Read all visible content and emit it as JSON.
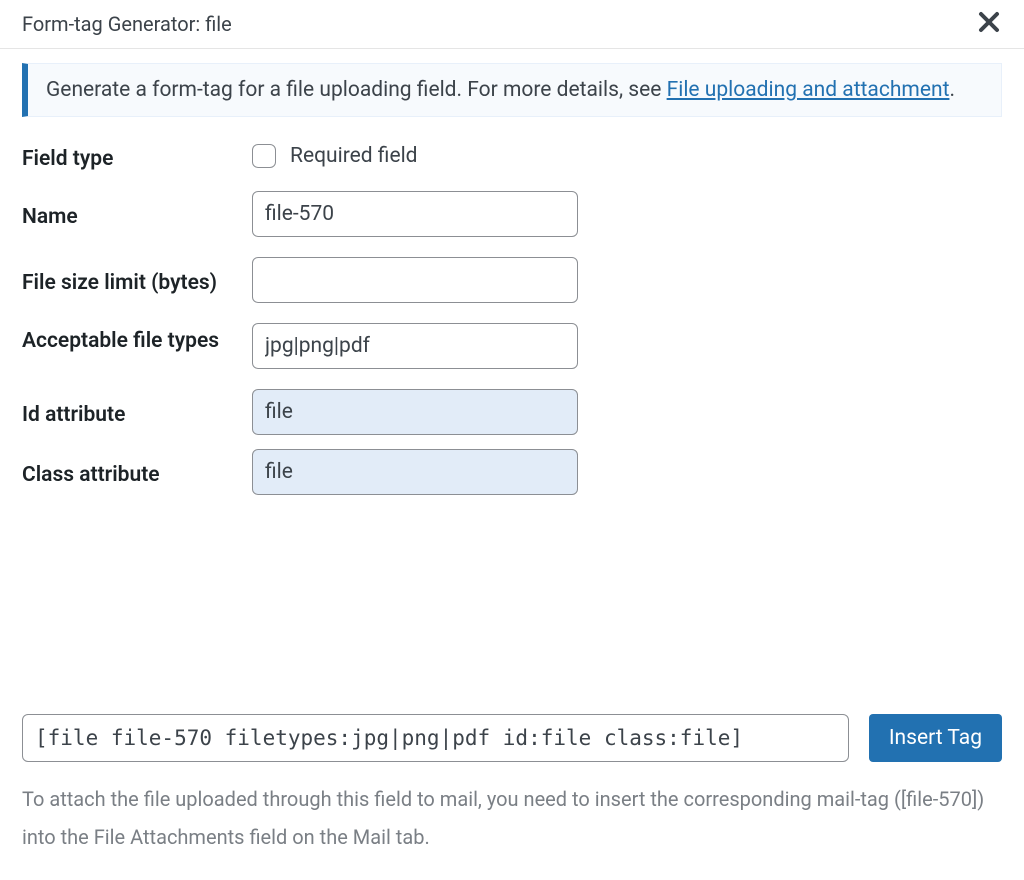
{
  "accent_color": "#2271b1",
  "header": {
    "title": "Form-tag Generator: file"
  },
  "description": {
    "text": "Generate a form-tag for a file uploading field. For more details, see ",
    "link_text": "File uploading and attachment",
    "suffix": "."
  },
  "fields": {
    "field_type": {
      "label": "Field type",
      "checkbox_label": "Required field",
      "checked": false
    },
    "name": {
      "label": "Name",
      "value": "file-570"
    },
    "limit": {
      "label": "File size limit (bytes)",
      "value": ""
    },
    "filetypes": {
      "label": "Acceptable file types",
      "value": "jpg|png|pdf"
    },
    "id_attr": {
      "label": "Id attribute",
      "value": "file"
    },
    "class_attr": {
      "label": "Class attribute",
      "value": "file"
    }
  },
  "output": {
    "tag": "[file file-570 filetypes:jpg|png|pdf id:file class:file]",
    "insert_label": "Insert Tag"
  },
  "help": {
    "pre": "To attach the file uploaded through this field to mail, you need to insert the corresponding mail-tag (",
    "mailtag": "[file-570]",
    "post": ") into the File Attachments field on the Mail tab."
  }
}
